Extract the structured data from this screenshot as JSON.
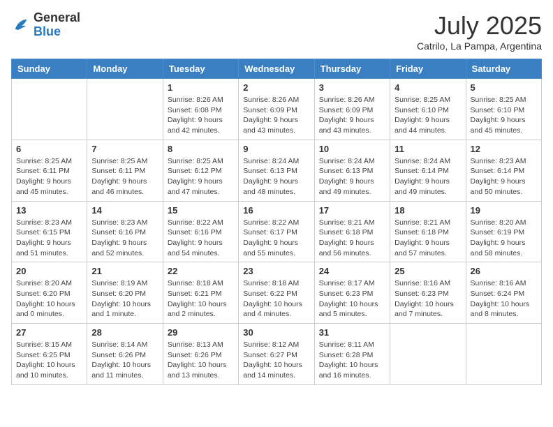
{
  "header": {
    "logo_general": "General",
    "logo_blue": "Blue",
    "month_title": "July 2025",
    "subtitle": "Catrilo, La Pampa, Argentina"
  },
  "weekdays": [
    "Sunday",
    "Monday",
    "Tuesday",
    "Wednesday",
    "Thursday",
    "Friday",
    "Saturday"
  ],
  "weeks": [
    [
      {
        "day": null,
        "info": null
      },
      {
        "day": null,
        "info": null
      },
      {
        "day": "1",
        "info": "Sunrise: 8:26 AM\nSunset: 6:08 PM\nDaylight: 9 hours and 42 minutes."
      },
      {
        "day": "2",
        "info": "Sunrise: 8:26 AM\nSunset: 6:09 PM\nDaylight: 9 hours and 43 minutes."
      },
      {
        "day": "3",
        "info": "Sunrise: 8:26 AM\nSunset: 6:09 PM\nDaylight: 9 hours and 43 minutes."
      },
      {
        "day": "4",
        "info": "Sunrise: 8:25 AM\nSunset: 6:10 PM\nDaylight: 9 hours and 44 minutes."
      },
      {
        "day": "5",
        "info": "Sunrise: 8:25 AM\nSunset: 6:10 PM\nDaylight: 9 hours and 45 minutes."
      }
    ],
    [
      {
        "day": "6",
        "info": "Sunrise: 8:25 AM\nSunset: 6:11 PM\nDaylight: 9 hours and 45 minutes."
      },
      {
        "day": "7",
        "info": "Sunrise: 8:25 AM\nSunset: 6:11 PM\nDaylight: 9 hours and 46 minutes."
      },
      {
        "day": "8",
        "info": "Sunrise: 8:25 AM\nSunset: 6:12 PM\nDaylight: 9 hours and 47 minutes."
      },
      {
        "day": "9",
        "info": "Sunrise: 8:24 AM\nSunset: 6:13 PM\nDaylight: 9 hours and 48 minutes."
      },
      {
        "day": "10",
        "info": "Sunrise: 8:24 AM\nSunset: 6:13 PM\nDaylight: 9 hours and 49 minutes."
      },
      {
        "day": "11",
        "info": "Sunrise: 8:24 AM\nSunset: 6:14 PM\nDaylight: 9 hours and 49 minutes."
      },
      {
        "day": "12",
        "info": "Sunrise: 8:23 AM\nSunset: 6:14 PM\nDaylight: 9 hours and 50 minutes."
      }
    ],
    [
      {
        "day": "13",
        "info": "Sunrise: 8:23 AM\nSunset: 6:15 PM\nDaylight: 9 hours and 51 minutes."
      },
      {
        "day": "14",
        "info": "Sunrise: 8:23 AM\nSunset: 6:16 PM\nDaylight: 9 hours and 52 minutes."
      },
      {
        "day": "15",
        "info": "Sunrise: 8:22 AM\nSunset: 6:16 PM\nDaylight: 9 hours and 54 minutes."
      },
      {
        "day": "16",
        "info": "Sunrise: 8:22 AM\nSunset: 6:17 PM\nDaylight: 9 hours and 55 minutes."
      },
      {
        "day": "17",
        "info": "Sunrise: 8:21 AM\nSunset: 6:18 PM\nDaylight: 9 hours and 56 minutes."
      },
      {
        "day": "18",
        "info": "Sunrise: 8:21 AM\nSunset: 6:18 PM\nDaylight: 9 hours and 57 minutes."
      },
      {
        "day": "19",
        "info": "Sunrise: 8:20 AM\nSunset: 6:19 PM\nDaylight: 9 hours and 58 minutes."
      }
    ],
    [
      {
        "day": "20",
        "info": "Sunrise: 8:20 AM\nSunset: 6:20 PM\nDaylight: 10 hours and 0 minutes."
      },
      {
        "day": "21",
        "info": "Sunrise: 8:19 AM\nSunset: 6:20 PM\nDaylight: 10 hours and 1 minute."
      },
      {
        "day": "22",
        "info": "Sunrise: 8:18 AM\nSunset: 6:21 PM\nDaylight: 10 hours and 2 minutes."
      },
      {
        "day": "23",
        "info": "Sunrise: 8:18 AM\nSunset: 6:22 PM\nDaylight: 10 hours and 4 minutes."
      },
      {
        "day": "24",
        "info": "Sunrise: 8:17 AM\nSunset: 6:23 PM\nDaylight: 10 hours and 5 minutes."
      },
      {
        "day": "25",
        "info": "Sunrise: 8:16 AM\nSunset: 6:23 PM\nDaylight: 10 hours and 7 minutes."
      },
      {
        "day": "26",
        "info": "Sunrise: 8:16 AM\nSunset: 6:24 PM\nDaylight: 10 hours and 8 minutes."
      }
    ],
    [
      {
        "day": "27",
        "info": "Sunrise: 8:15 AM\nSunset: 6:25 PM\nDaylight: 10 hours and 10 minutes."
      },
      {
        "day": "28",
        "info": "Sunrise: 8:14 AM\nSunset: 6:26 PM\nDaylight: 10 hours and 11 minutes."
      },
      {
        "day": "29",
        "info": "Sunrise: 8:13 AM\nSunset: 6:26 PM\nDaylight: 10 hours and 13 minutes."
      },
      {
        "day": "30",
        "info": "Sunrise: 8:12 AM\nSunset: 6:27 PM\nDaylight: 10 hours and 14 minutes."
      },
      {
        "day": "31",
        "info": "Sunrise: 8:11 AM\nSunset: 6:28 PM\nDaylight: 10 hours and 16 minutes."
      },
      {
        "day": null,
        "info": null
      },
      {
        "day": null,
        "info": null
      }
    ]
  ]
}
